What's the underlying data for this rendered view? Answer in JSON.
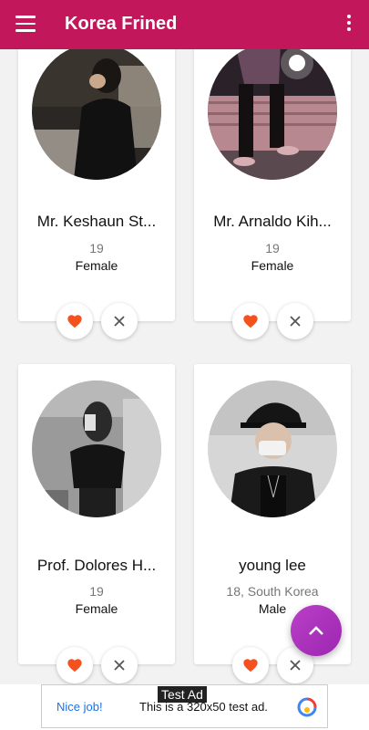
{
  "app": {
    "title": "Korea Frined",
    "accent": "#c2185b",
    "fab_color": "#9c27b0",
    "like_color": "#f4511e"
  },
  "icons": {
    "menu": "hamburger-icon",
    "more": "more-vert-icon",
    "like": "heart-icon",
    "dismiss": "close-icon",
    "scroll_top": "chevron-up-icon"
  },
  "cards": [
    {
      "name": "Mr. Keshaun St...",
      "age": "19",
      "gender": "Female"
    },
    {
      "name": "Mr. Arnaldo Kih...",
      "age": "19",
      "gender": "Female"
    },
    {
      "name": "Prof. Dolores H...",
      "age": "19",
      "gender": "Female"
    },
    {
      "name": "young lee",
      "age": "18, South Korea",
      "gender": "Male"
    }
  ],
  "ad": {
    "label": "Test Ad",
    "left_text": "Nice job!",
    "text": "This is a 320x50 test ad."
  }
}
